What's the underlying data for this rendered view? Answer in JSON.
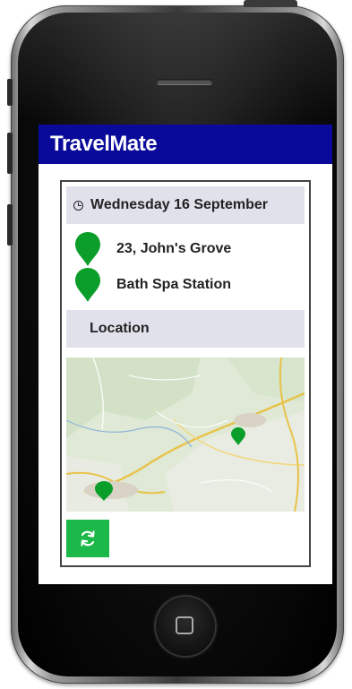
{
  "app": {
    "title": "TravelMate"
  },
  "trip": {
    "date": "Wednesday 16 September",
    "stops": [
      {
        "label": "23, John's Grove"
      },
      {
        "label": "Bath Spa Station"
      }
    ]
  },
  "location_section": {
    "label": "Location"
  },
  "icons": {
    "clock": "clock-icon",
    "pin": "map-pin-icon",
    "refresh": "refresh-icon",
    "home": "home-button-icon"
  },
  "colors": {
    "header": "#0a0a9a",
    "section_bar": "#e1e1ec",
    "pin": "#0b9e2a",
    "refresh_button": "#1cb84a"
  }
}
